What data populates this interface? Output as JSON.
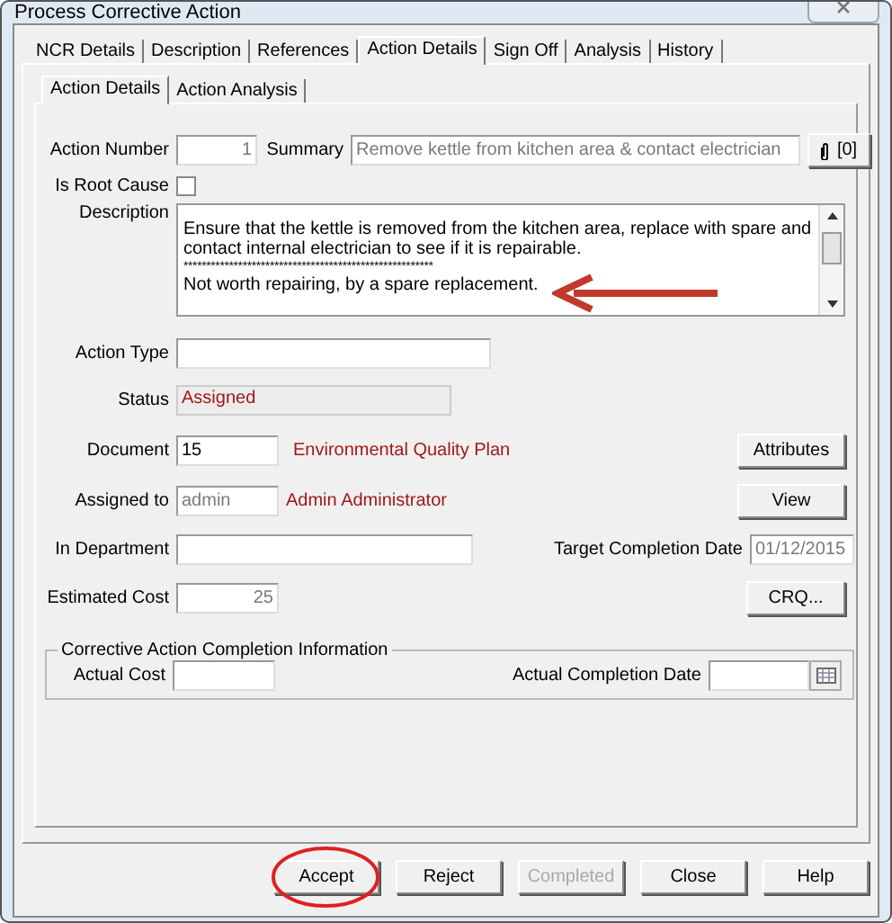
{
  "window": {
    "title": "Process Corrective Action"
  },
  "tabs": [
    {
      "label": "NCR Details",
      "selected": false
    },
    {
      "label": "Description",
      "selected": false
    },
    {
      "label": "References",
      "selected": false
    },
    {
      "label": "Action Details",
      "selected": true
    },
    {
      "label": "Sign Off",
      "selected": false
    },
    {
      "label": "Analysis",
      "selected": false
    },
    {
      "label": "History",
      "selected": false
    }
  ],
  "subtabs": [
    {
      "label": "Action Details",
      "selected": true
    },
    {
      "label": "Action Analysis",
      "selected": false
    }
  ],
  "action_number": {
    "label": "Action Number",
    "value": "1",
    "disabled": true
  },
  "summary": {
    "label": "Summary",
    "value": "Remove kettle from kitchen area & contact electrician",
    "disabled": true
  },
  "attachments": {
    "count": "[0]"
  },
  "is_root_cause": {
    "label": "Is Root Cause",
    "checked": false
  },
  "description": {
    "label": "Description",
    "lines": [
      "Ensure that the kettle is removed from the kitchen area, replace with spare and contact internal electrician to see if it is repairable.",
      "*******************************************************",
      "Not worth repairing, by a spare replacement."
    ]
  },
  "action_type": {
    "label": "Action Type"
  },
  "status": {
    "label": "Status",
    "value": "Assigned"
  },
  "document": {
    "label": "Document",
    "value": "15",
    "name": "Environmental Quality Plan"
  },
  "assigned_to": {
    "label": "Assigned to",
    "value": "admin",
    "disabled": true,
    "name": "Admin Administrator"
  },
  "in_department": {
    "label": "In Department"
  },
  "target_completion_date": {
    "label": "Target Completion Date",
    "value": "01/12/2015",
    "disabled": true
  },
  "estimated_cost": {
    "label": "Estimated Cost",
    "value": "25",
    "disabled": true
  },
  "side_buttons": [
    "Attributes",
    "View",
    "CRQ..."
  ],
  "completion_group": {
    "title": "Corrective Action Completion Information",
    "actual_cost": {
      "label": "Actual Cost"
    },
    "actual_completion_date": {
      "label": "Actual Completion Date"
    }
  },
  "buttons": [
    {
      "label": "Accept",
      "disabled": false
    },
    {
      "label": "Reject",
      "disabled": false
    },
    {
      "label": "Completed",
      "disabled": true
    },
    {
      "label": "Close",
      "disabled": false
    },
    {
      "label": "Help",
      "disabled": false
    }
  ]
}
